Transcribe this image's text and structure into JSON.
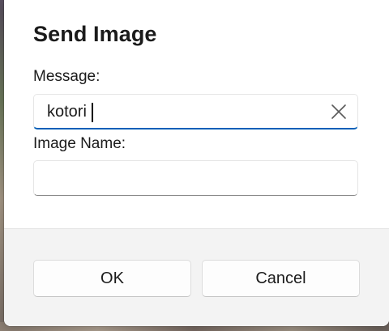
{
  "dialog": {
    "title": "Send Image",
    "message": {
      "label": "Message:",
      "value": "kotori",
      "clear_icon": "close-icon"
    },
    "image_name": {
      "label": "Image Name:",
      "value": ""
    },
    "buttons": {
      "ok_label": "OK",
      "cancel_label": "Cancel"
    }
  },
  "colors": {
    "accent": "#005fb8",
    "footer_bg": "#f3f3f3",
    "text": "#1b1b1b"
  }
}
